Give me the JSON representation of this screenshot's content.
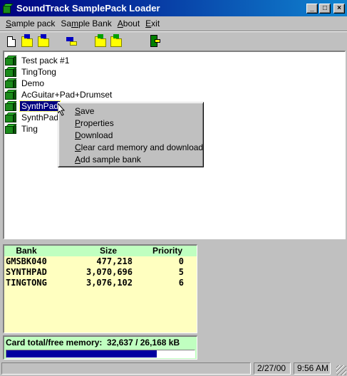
{
  "window": {
    "title": "SoundTrack SamplePack Loader"
  },
  "menu": [
    {
      "pre": "",
      "ul": "S",
      "post": "ample pack"
    },
    {
      "pre": "Sa",
      "ul": "m",
      "post": "ple Bank"
    },
    {
      "pre": "",
      "ul": "A",
      "post": "bout"
    },
    {
      "pre": "",
      "ul": "E",
      "post": "xit"
    }
  ],
  "tree": {
    "items": [
      {
        "label": "Test pack #1"
      },
      {
        "label": "TingTong"
      },
      {
        "label": "Demo"
      },
      {
        "label": "AcGuitar+Pad+Drumset"
      },
      {
        "label": "SynthPad",
        "selected": true
      },
      {
        "label": "SynthPad +"
      },
      {
        "label": "Ting"
      }
    ]
  },
  "context_menu": {
    "items": [
      {
        "pre": "",
        "ul": "S",
        "post": "ave"
      },
      {
        "pre": "",
        "ul": "P",
        "post": "roperties"
      },
      {
        "pre": "",
        "ul": "D",
        "post": "ownload"
      },
      {
        "pre": "",
        "ul": "C",
        "post": "lear card memory and download"
      },
      {
        "pre": "",
        "ul": "A",
        "post": "dd sample bank"
      }
    ]
  },
  "bank_table": {
    "headers": [
      "Bank",
      "Size",
      "Priority"
    ],
    "rows": [
      [
        "GMSBK040",
        "477,218",
        "0"
      ],
      [
        "SYNTHPAD",
        "3,070,696",
        "5"
      ],
      [
        "TINGTONG",
        "3,076,102",
        "6"
      ]
    ]
  },
  "memory": {
    "label": "Card total/free memory:",
    "value": "32,637 / 26,168 kB",
    "used_fraction": 0.8
  },
  "statusbar": {
    "text": "",
    "date": "2/27/00",
    "time": "9:56 AM"
  },
  "colors": {
    "titlebar": "#000080",
    "selection": "#000080",
    "bank_bg": "#ffffc0",
    "header_bg": "#c0ffc0",
    "progress": "#0000a0"
  }
}
